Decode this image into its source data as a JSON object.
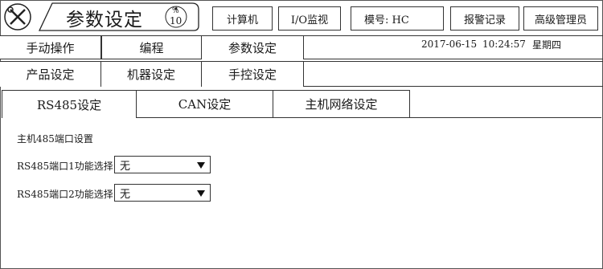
{
  "header": {
    "title": "参数设定",
    "page_percent_symbol": "%",
    "page_number": "10",
    "buttons": {
      "computer": "计算机",
      "io_monitor": "I/O监视",
      "mold": "模号: HC",
      "alarm_log": "报警记录",
      "admin": "高级管理员"
    }
  },
  "main_tabs": [
    "手动操作",
    "编程",
    "参数设定"
  ],
  "status": {
    "date": "2017-06-15",
    "time": "10:24:57",
    "weekday": "星期四"
  },
  "sub_tabs": [
    "产品设定",
    "机器设定",
    "手控设定"
  ],
  "comm_tabs": [
    "RS485设定",
    "CAN设定",
    "主机网络设定"
  ],
  "panel": {
    "section_title": "主机485端口设置",
    "port1_label": "RS485端口1功能选择",
    "port1_value": "无",
    "port2_label": "RS485端口2功能选择",
    "port2_value": "无"
  }
}
